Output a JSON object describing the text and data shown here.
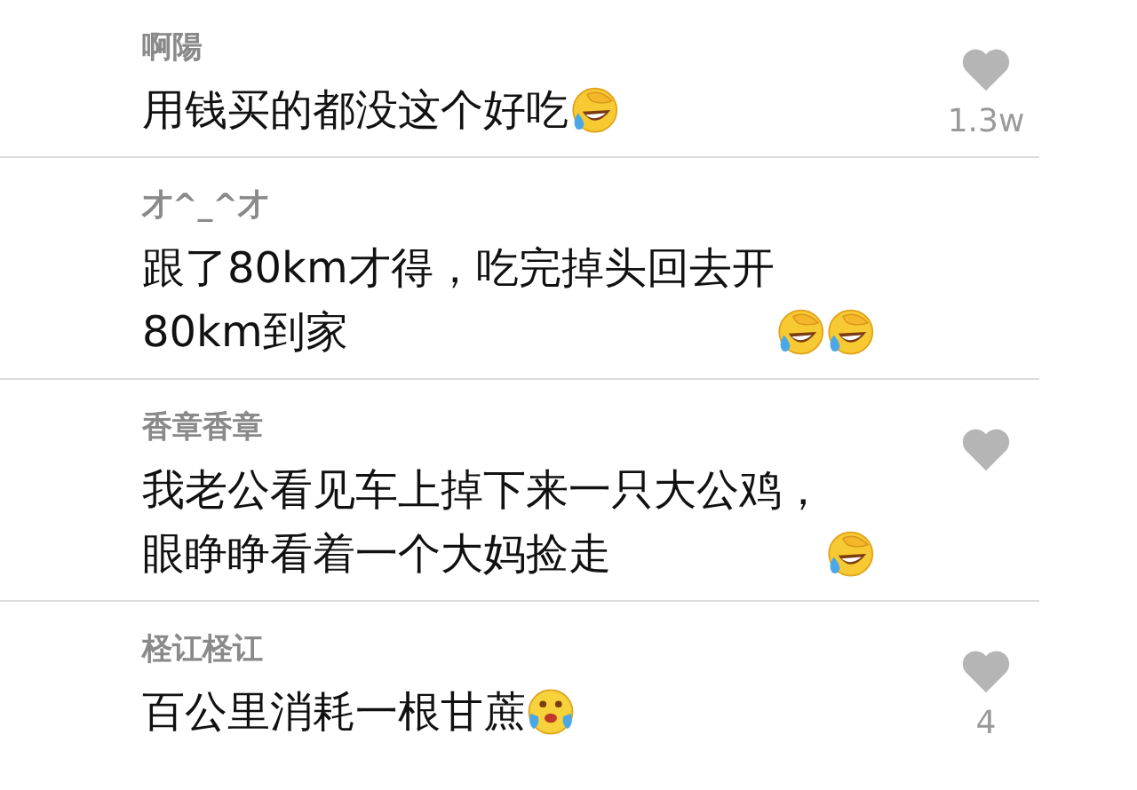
{
  "comments": [
    {
      "name": "啊陽",
      "lines": [
        "用钱买的都没这个好吃"
      ],
      "emoji": [
        {
          "kind": "facepalm"
        }
      ],
      "liked": true,
      "likes": "1.3w"
    },
    {
      "name": "才^_^才",
      "lines": [
        "跟了80km才得，吃完掉头回去开",
        "80km到家"
      ],
      "emoji": [
        {
          "kind": "facepalm"
        },
        {
          "kind": "facepalm"
        }
      ],
      "liked": false
    },
    {
      "name": "香章香章",
      "lines": [
        "我老公看见车上掉下来一只大公鸡，",
        "眼睁睁看着一个大妈捡走"
      ],
      "emoji": [
        {
          "kind": "facepalm"
        }
      ],
      "liked": true
    },
    {
      "name": "柽讧柽讧",
      "lines": [
        "百公里消耗一根甘蔗"
      ],
      "emoji": [
        {
          "kind": "tears"
        }
      ],
      "liked": true,
      "likes": "4"
    }
  ]
}
